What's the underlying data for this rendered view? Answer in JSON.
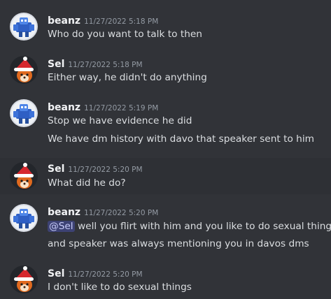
{
  "messages": [
    {
      "user": "beanz",
      "timestamp": "11/27/2022 5:18 PM",
      "avatar_icon": "blue-robot-avatar",
      "lines": [
        "Who do you want to talk to then"
      ]
    },
    {
      "user": "Sel",
      "timestamp": "11/27/2022 5:18 PM",
      "avatar_icon": "santa-hat-fox-avatar",
      "lines": [
        "Either way, he didn't do anything"
      ]
    },
    {
      "user": "beanz",
      "timestamp": "11/27/2022 5:19 PM",
      "avatar_icon": "blue-robot-avatar",
      "lines": [
        "Stop we have evidence he did",
        "We have dm history with davo that speaker sent to him"
      ]
    },
    {
      "user": "Sel",
      "timestamp": "11/27/2022 5:20 PM",
      "avatar_icon": "santa-hat-fox-avatar",
      "lines": [
        "What did he do?"
      ]
    },
    {
      "user": "beanz",
      "timestamp": "11/27/2022 5:20 PM",
      "avatar_icon": "blue-robot-avatar",
      "mention": "@Sel",
      "lines": [
        " well you flirt with him and you like to do sexual things",
        "and speaker was always mentioning you in davos dms"
      ]
    },
    {
      "user": "Sel",
      "timestamp": "11/27/2022 5:20 PM",
      "avatar_icon": "santa-hat-fox-avatar",
      "lines": [
        "I don't like to do sexual things"
      ]
    }
  ],
  "colors": {
    "background": "#313338",
    "hover_background": "#2e3035",
    "mention_text": "#c9cdfb"
  }
}
